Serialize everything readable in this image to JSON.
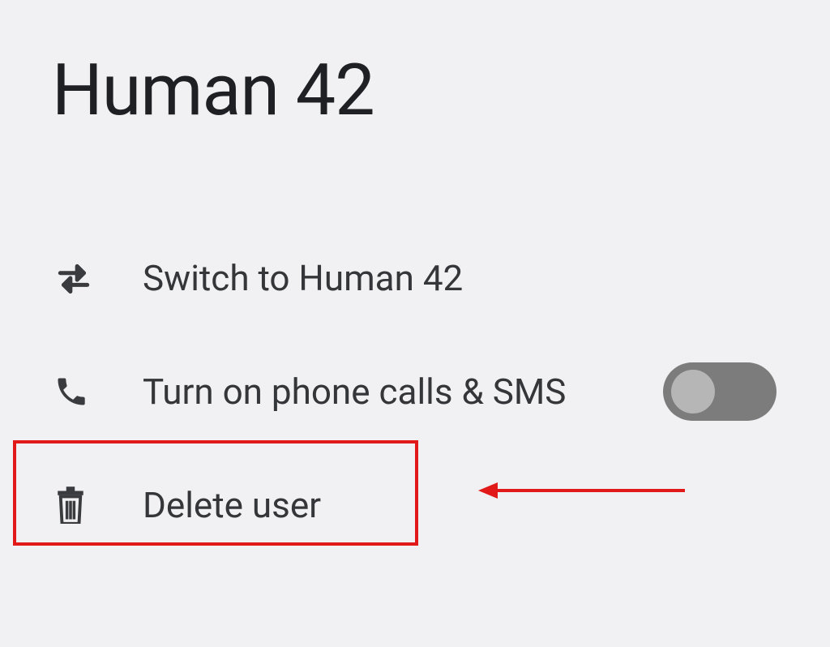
{
  "page": {
    "title": "Human 42"
  },
  "items": {
    "switch": {
      "label": "Switch to Human 42"
    },
    "phone": {
      "label": "Turn on phone calls & SMS",
      "toggled": false
    },
    "delete": {
      "label": "Delete user"
    }
  },
  "annotations": {
    "highlight_color": "#e11919",
    "arrow_color": "#e11919"
  }
}
